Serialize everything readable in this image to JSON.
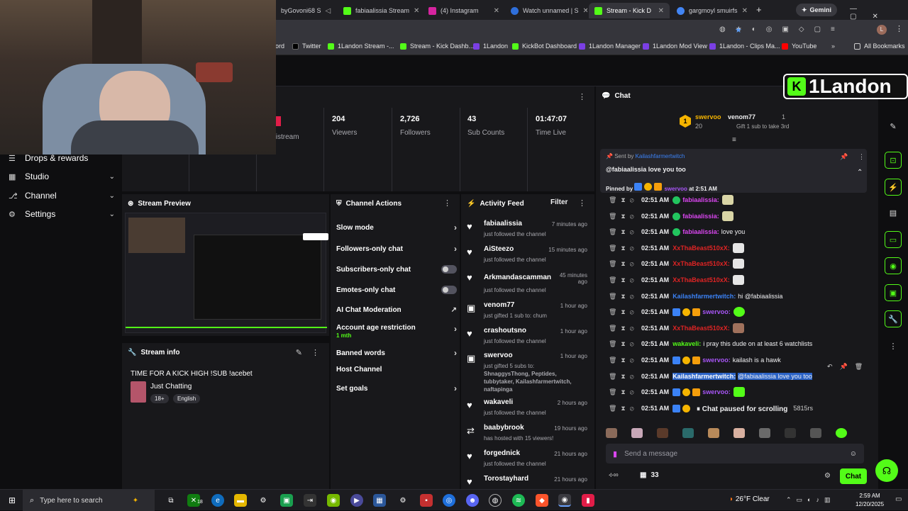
{
  "browser": {
    "tabs": [
      {
        "label": "byGovoni68 S",
        "color": "#3b3b3b"
      },
      {
        "label": "fabiaalissia Stream",
        "color": "#53fc18"
      },
      {
        "label": "(4) Instagram",
        "color": "#d6249f"
      },
      {
        "label": "Watch unnamed | S",
        "color": "#2f6fdb"
      },
      {
        "label": "Stream - Kick D",
        "color": "#53fc18"
      },
      {
        "label": "gargmoyl smuirfs",
        "color": "#4285f4"
      }
    ],
    "gemini_label": "Gemini",
    "bookmarks": [
      {
        "label": "ord",
        "color": "#7b3fe4"
      },
      {
        "label": "Twitter",
        "color": "#000000"
      },
      {
        "label": "1Landon Stream -...",
        "color": "#53fc18"
      },
      {
        "label": "Stream - Kick Dashb...",
        "color": "#53fc18"
      },
      {
        "label": "1Landon",
        "color": "#7b3fe4"
      },
      {
        "label": "KickBot Dashboard",
        "color": "#53fc18"
      },
      {
        "label": "1Landon Manager",
        "color": "#7b3fe4"
      },
      {
        "label": "1Landon Mod View",
        "color": "#7b3fe4"
      },
      {
        "label": "1Landon - Clips Ma...",
        "color": "#7b3fe4"
      },
      {
        "label": "YouTube",
        "color": "#ff0000"
      }
    ],
    "all_bookmarks": "All Bookmarks"
  },
  "overlay_logo": "1Landon",
  "nav": {
    "drops": "Drops & rewards",
    "studio": "Studio",
    "channel": "Channel",
    "settings": "Settings"
  },
  "stats": {
    "stream_label": "tistream",
    "viewers": {
      "value": "204",
      "label": "Viewers"
    },
    "followers": {
      "value": "2,726",
      "label": "Followers"
    },
    "subs": {
      "value": "43",
      "label": "Sub Counts"
    },
    "time": {
      "value": "01:47:07",
      "label": "Time Live"
    }
  },
  "preview": {
    "title": "Stream Preview"
  },
  "stream_info": {
    "title": "Stream info",
    "stream_title": "TIME FOR A KICK HIGH !SUB !acebet",
    "category": "Just Chatting",
    "tags": [
      "18+",
      "English"
    ]
  },
  "channel_actions": {
    "title": "Channel Actions",
    "items": [
      {
        "label": "Slow mode",
        "extra": ""
      },
      {
        "label": "Followers-only chat",
        "extra": ""
      },
      {
        "label": "Subscribers-only chat",
        "extra": ""
      },
      {
        "label": "Emotes-only chat",
        "extra": ""
      },
      {
        "label": "AI Chat Moderation",
        "extra": ""
      },
      {
        "label": "Account age restriction",
        "extra": "1 mth"
      },
      {
        "label": "Banned words",
        "extra": ""
      },
      {
        "label": "Host Channel",
        "extra": ""
      },
      {
        "label": "Set goals",
        "extra": ""
      }
    ]
  },
  "activity": {
    "title": "Activity Feed",
    "filter": "Filter",
    "items": [
      {
        "name": "fabiaalissia",
        "time": "7 minutes ago",
        "desc": "just followed the channel"
      },
      {
        "name": "AiSteezo",
        "time": "15 minutes ago",
        "desc": "just followed the channel"
      },
      {
        "name": "Arkmandascamman",
        "time": "45 minutes ago",
        "desc": "just followed the channel"
      },
      {
        "name": "venom77",
        "time": "1 hour ago",
        "desc": "just gifted 1 sub to: chum"
      },
      {
        "name": "crashoutsno",
        "time": "1 hour ago",
        "desc": "just followed the channel"
      },
      {
        "name": "swervoo",
        "time": "1 hour ago",
        "desc": "just gifted 5 subs to:",
        "extra": "ShnaggysThong, Peptides, tubbytaker, Kailashfarmertwitch, naftapinga"
      },
      {
        "name": "wakaveli",
        "time": "2 hours ago",
        "desc": "just followed the channel"
      },
      {
        "name": "baabybrook",
        "time": "19 hours ago",
        "desc": "has hosted with 15 viewers!"
      },
      {
        "name": "forgednick",
        "time": "21 hours ago",
        "desc": "just followed the channel"
      },
      {
        "name": "Torostayhard",
        "time": "21 hours ago",
        "desc": ""
      }
    ]
  },
  "chat": {
    "title": "Chat",
    "gifter": {
      "name": "swervoo",
      "count": "20"
    },
    "gifter2": {
      "name": "venom77",
      "count": "1",
      "sub": "Gift 1 sub to take 3rd"
    },
    "pinned": {
      "sent_by_label": "Sent by",
      "sent_by": "Kailashfarmertwitch",
      "message": "@fabiaalissia love you too",
      "pinned_by_label": "Pinned by",
      "pinned_by": "swervoo",
      "pinned_time": "at 2:51 AM"
    },
    "messages": [
      {
        "time": "02:51 AM",
        "user": "fabiaalissia:",
        "color": "#d946ef",
        "text": ""
      },
      {
        "time": "02:51 AM",
        "user": "fabiaalissia:",
        "color": "#d946ef",
        "text": ""
      },
      {
        "time": "02:51 AM",
        "user": "fabiaalissia:",
        "color": "#d946ef",
        "text": "love you"
      },
      {
        "time": "02:51 AM",
        "user": "XxThaBeast510xX:",
        "color": "#e02424",
        "text": ""
      },
      {
        "time": "02:51 AM",
        "user": "XxThaBeast510xX:",
        "color": "#e02424",
        "text": ""
      },
      {
        "time": "02:51 AM",
        "user": "XxThaBeast510xX:",
        "color": "#e02424",
        "text": ""
      },
      {
        "time": "02:51 AM",
        "user": "Kailashfarmertwitch:",
        "color": "#3b82f6",
        "text": "hi @fabiaalissia"
      },
      {
        "time": "02:51 AM",
        "user": "swervoo:",
        "color": "#a855f7",
        "text": ""
      },
      {
        "time": "02:51 AM",
        "user": "XxThaBeast510xX:",
        "color": "#e02424",
        "text": ""
      },
      {
        "time": "02:51 AM",
        "user": "wakaveli:",
        "color": "#53fc18",
        "text": "i pray this dude on at least 6 watchlists"
      },
      {
        "time": "02:51 AM",
        "user": "swervoo:",
        "color": "#a855f7",
        "text": "kailash is a hawk"
      },
      {
        "time": "02:51 AM",
        "user": "Kailashfarmertwitch:",
        "color": "#3b82f6",
        "text": "@fabiaalissia love you too"
      },
      {
        "time": "02:51 AM",
        "user": "swervoo:",
        "color": "#a855f7",
        "text": ""
      },
      {
        "time": "02:51 AM",
        "user": "",
        "color": "#a855f7",
        "text": "om/5815rs"
      }
    ],
    "paused": "Chat paused for scrolling",
    "placeholder": "Send a message",
    "viewer_count": "33",
    "send_label": "Chat"
  },
  "taskbar": {
    "search_placeholder": "Type here to search",
    "weather": "26°F  Clear",
    "time": "2:59 AM",
    "date": "12/20/2025",
    "badge": "18"
  },
  "colors": {
    "brand": "#53fc18",
    "panel": "#18181b",
    "bg": "#0e0e10"
  }
}
